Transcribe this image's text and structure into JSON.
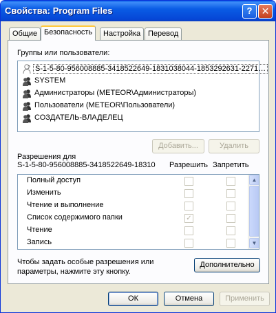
{
  "window": {
    "title": "Свойства: Program Files",
    "help_glyph": "?",
    "close_glyph": "✕"
  },
  "tabs": [
    {
      "label": "Общие",
      "active": false
    },
    {
      "label": "Безопасность",
      "active": true
    },
    {
      "label": "Настройка",
      "active": false
    },
    {
      "label": "Перевод",
      "active": false
    }
  ],
  "security": {
    "groups_label": "Группы или пользователи:",
    "users": [
      {
        "label": "S-1-5-80-956008885-3418522649-1831038044-1853292631-2271…",
        "selected": true
      },
      {
        "label": "SYSTEM",
        "selected": false
      },
      {
        "label": "Администраторы (METEOR\\Администраторы)",
        "selected": false
      },
      {
        "label": "Пользователи (METEOR\\Пользователи)",
        "selected": false
      },
      {
        "label": "СОЗДАТЕЛЬ-ВЛАДЕЛЕЦ",
        "selected": false
      }
    ],
    "add_button": "Добавить...",
    "remove_button": "Удалить",
    "permissions_for_label": "Разрешения для",
    "permissions_for_subject": "S-1-5-80-956008885-3418522649-18310",
    "allow_header": "Разрешить",
    "deny_header": "Запретить",
    "permissions": [
      {
        "name": "Полный доступ",
        "allow": false,
        "deny": false
      },
      {
        "name": "Изменить",
        "allow": false,
        "deny": false
      },
      {
        "name": "Чтение и выполнение",
        "allow": false,
        "deny": false
      },
      {
        "name": "Список содержимого папки",
        "allow": true,
        "deny": false
      },
      {
        "name": "Чтение",
        "allow": false,
        "deny": false
      },
      {
        "name": "Запись",
        "allow": false,
        "deny": false
      }
    ],
    "advanced_text_line1": "Чтобы задать особые разрешения или",
    "advanced_text_line2": "параметры, нажмите эту кнопку.",
    "advanced_button": "Дополнительно"
  },
  "footer": {
    "ok_button": "ОК",
    "cancel_button": "Отмена",
    "apply_button": "Применить"
  },
  "colors": {
    "titlebar": "#0a5ce5",
    "dialog_bg": "#ece9d8",
    "active_tab_highlight": "#ffc83c",
    "list_border": "#7f9db9"
  }
}
